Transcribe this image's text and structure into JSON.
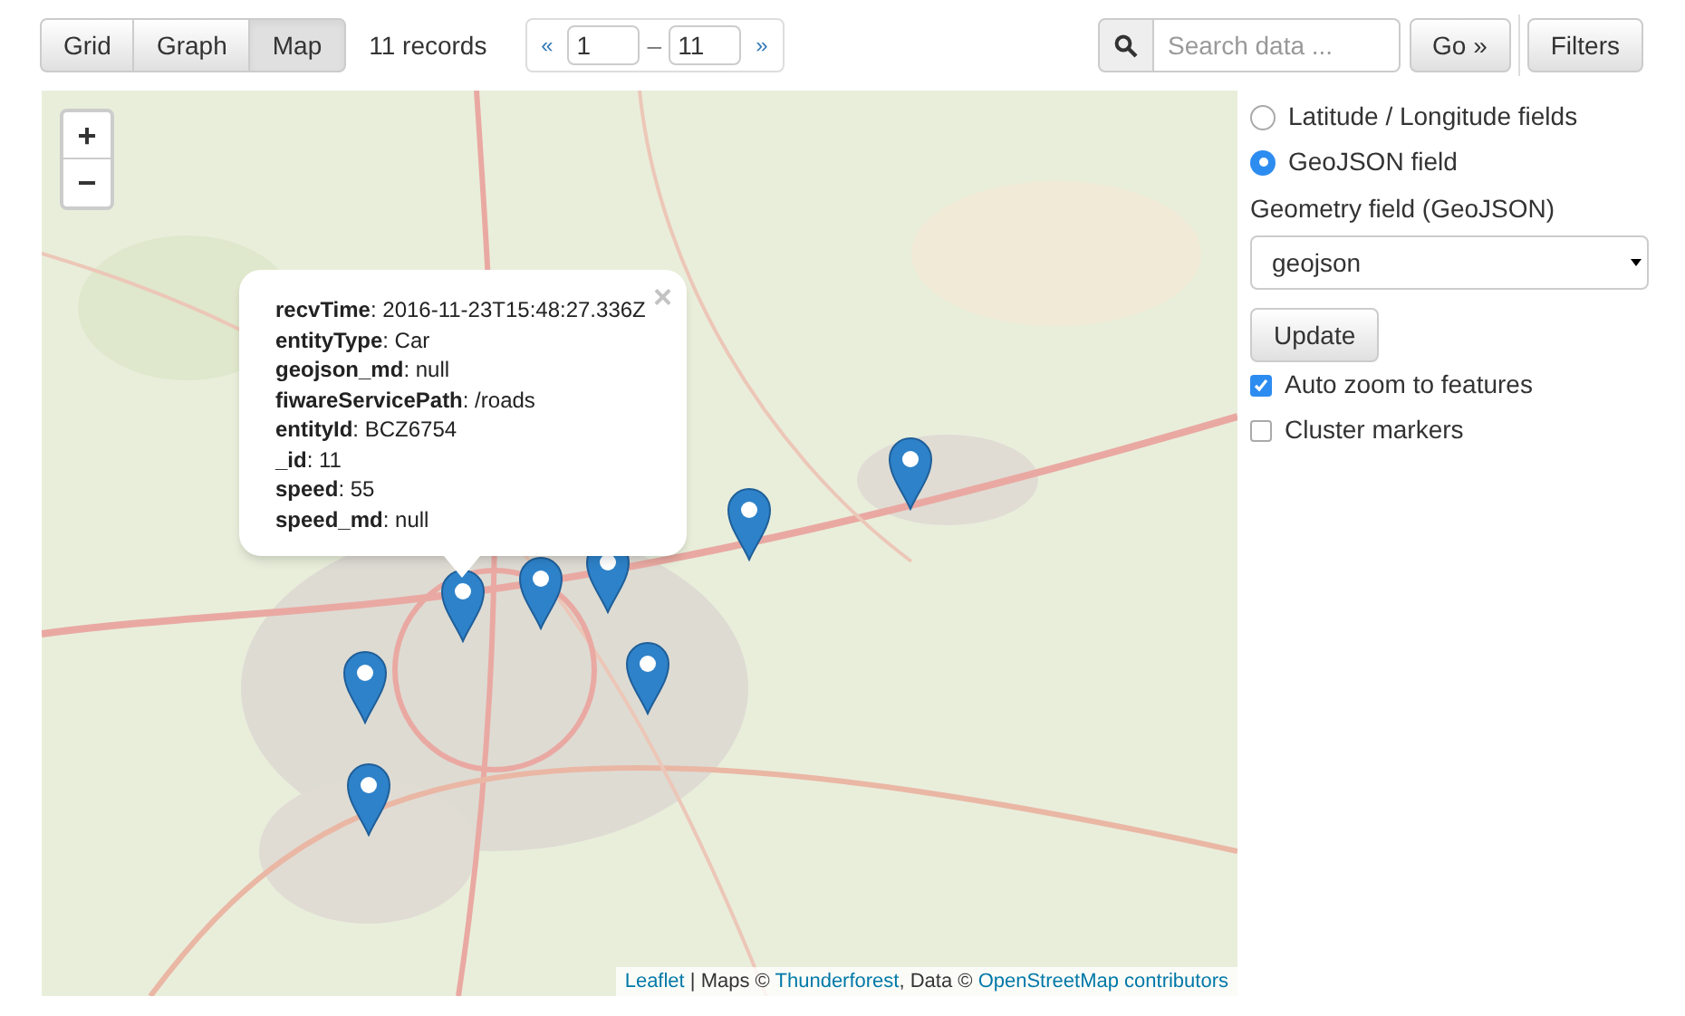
{
  "view_tabs": [
    {
      "label": "Grid",
      "selected": false
    },
    {
      "label": "Graph",
      "selected": false
    },
    {
      "label": "Map",
      "selected": true
    }
  ],
  "record_count": "11 records",
  "pager": {
    "prev": "«",
    "from": "1",
    "separator": "–",
    "to": "11",
    "next": "»"
  },
  "search": {
    "placeholder": "Search data ..."
  },
  "go_button": "Go »",
  "filters_button": "Filters",
  "map": {
    "zoom_in": "+",
    "zoom_out": "−",
    "popup": {
      "close": "×",
      "lines": [
        "**recvTime**: 2016-11-23T15:48:27.336Z",
        "**entityType**: Car",
        "**geojson_md**: null",
        "**fiwareServicePath**: /roads",
        "**entityId**: BCZ6754",
        "**_id**: 11",
        "**speed**: 55",
        "**speed_md**: null"
      ]
    },
    "attribution": [
      {
        "kind": "link",
        "text": "Leaflet"
      },
      {
        "kind": "text",
        "text": " | Maps © "
      },
      {
        "kind": "link",
        "text": "Thunderforest"
      },
      {
        "kind": "text",
        "text": ", Data © "
      },
      {
        "kind": "link",
        "text": "OpenStreetMap contributors"
      }
    ]
  },
  "options": {
    "source": [
      {
        "label": "Latitude / Longitude fields",
        "selected": false
      },
      {
        "label": "GeoJSON field",
        "selected": true
      }
    ],
    "geometry_label": "Geometry field (GeoJSON)",
    "geometry_value": "geojson",
    "update_button": "Update",
    "checks": [
      {
        "label": "Auto zoom to features",
        "checked": true
      },
      {
        "label": "Cluster markers",
        "checked": false
      }
    ]
  }
}
